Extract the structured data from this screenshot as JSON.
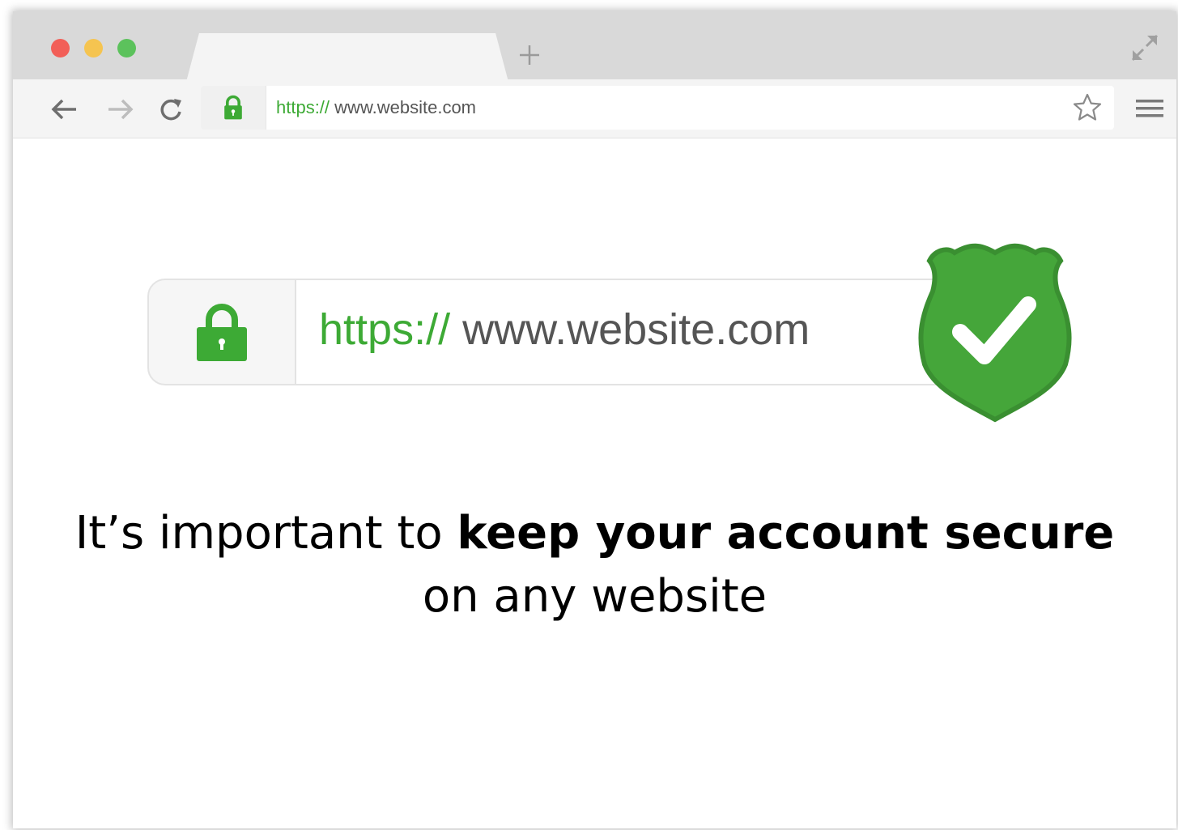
{
  "window": {
    "traffic_lights": {
      "close_color": "#f25f58",
      "minimize_color": "#f5c450",
      "maximize_color": "#5cc25c"
    },
    "new_tab_icon": "plus-icon",
    "fullscreen_icon": "expand-arrows-icon"
  },
  "toolbar": {
    "back_icon": "arrow-left-icon",
    "forward_icon": "arrow-right-icon",
    "reload_icon": "reload-icon",
    "address": {
      "lock_icon": "padlock-icon",
      "protocol": "https://",
      "domain": "www.website.com"
    },
    "bookmark_icon": "star-icon",
    "menu_icon": "hamburger-menu-icon"
  },
  "content": {
    "illustration": {
      "protocol": "https://",
      "domain": "www.website.com",
      "lock_icon": "padlock-icon",
      "shield_icon": "shield-checkmark-icon"
    },
    "message": {
      "prefix": "It’s important to ",
      "emphasis": "keep your account secure",
      "suffix": "on any website"
    }
  },
  "colors": {
    "secure_green": "#3daa35",
    "shield_green": "#45a63a",
    "text_gray": "#555555"
  }
}
